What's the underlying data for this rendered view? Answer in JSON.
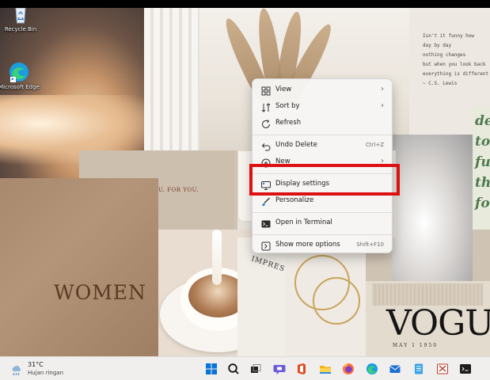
{
  "desktop": {
    "icons": [
      {
        "label": "Recycle Bin",
        "icon": "recycle-bin-icon"
      },
      {
        "label": "Microsoft Edge",
        "icon": "edge-icon"
      }
    ],
    "wallpaper": {
      "card_text": "WORK ON YOU, FOR YOU.",
      "women_text": "WOMEN",
      "quote_lines": [
        "Isn't it funny how",
        "day by day",
        "nothing changes",
        "but when you look back",
        "everything is different",
        "",
        "~ C.S. Lewis"
      ],
      "green_text": [
        "de",
        "to",
        "fu",
        "th",
        "fo"
      ],
      "magazine_text": "IMPRESSIO",
      "vogue_text": "VOGUE",
      "vogue_date": "MAY 1 1950"
    }
  },
  "context_menu": {
    "items": [
      {
        "label": "View",
        "icon": "grid-icon",
        "submenu": true
      },
      {
        "label": "Sort by",
        "icon": "sort-icon",
        "submenu": true
      },
      {
        "label": "Refresh",
        "icon": "refresh-icon"
      },
      {
        "label": "Undo Delete",
        "icon": "undo-icon",
        "shortcut": "Ctrl+Z"
      },
      {
        "label": "New",
        "icon": "new-icon",
        "submenu": true
      },
      {
        "label": "Display settings",
        "icon": "display-icon",
        "highlighted": true
      },
      {
        "label": "Personalize",
        "icon": "brush-icon"
      },
      {
        "label": "Open in Terminal",
        "icon": "terminal-icon"
      },
      {
        "label": "Show more options",
        "icon": "more-options-icon",
        "shortcut": "Shift+F10"
      }
    ],
    "arrow_glyph": "›"
  },
  "highlight_color": "#dd1111",
  "taskbar": {
    "weather": {
      "temp": "31°C",
      "condition": "Hujan ringan",
      "icon": "weather-rain-icon"
    },
    "apps": [
      "windows-start-icon",
      "search-icon",
      "task-view-icon",
      "teams-chat-icon",
      "office-icon",
      "file-explorer-icon",
      "firefox-icon",
      "edge-icon",
      "mail-icon",
      "notepad-icon",
      "snipping-tool-icon",
      "terminal-icon"
    ]
  }
}
